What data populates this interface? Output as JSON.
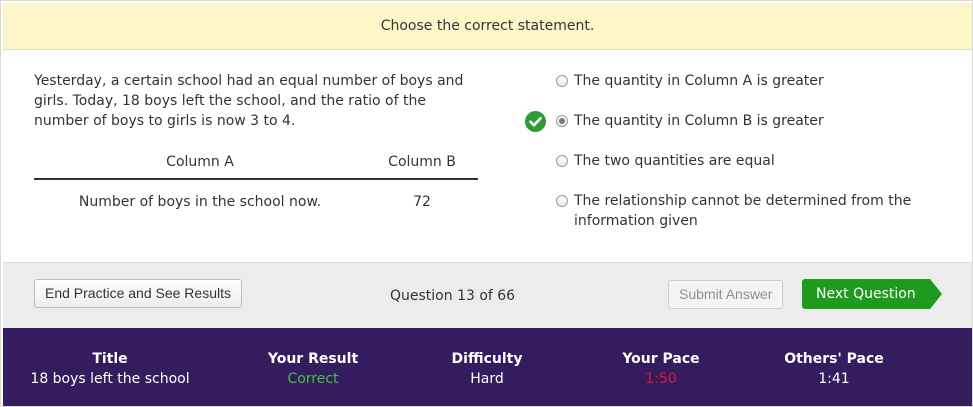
{
  "banner": {
    "text": "Choose the correct statement."
  },
  "question": {
    "text": "Yesterday, a certain school had an equal number of boys and girls. Today, 18 boys left the school, and the ratio of the number of boys to girls is now 3 to 4."
  },
  "table": {
    "column_a_header": "Column A",
    "column_b_header": "Column B",
    "column_a_value": "Number of boys in the school now.",
    "column_b_value": "72"
  },
  "options": [
    {
      "label": "The quantity in Column A is greater",
      "selected": false,
      "correct": false
    },
    {
      "label": "The quantity in Column B is greater",
      "selected": true,
      "correct": true
    },
    {
      "label": "The two quantities are equal",
      "selected": false,
      "correct": false
    },
    {
      "label": "The relationship cannot be determined from the information given",
      "selected": false,
      "correct": false
    }
  ],
  "actions": {
    "end_label": "End Practice and See Results",
    "question_counter": "Question 13 of 66",
    "submit_label": "Submit Answer",
    "next_label": "Next Question"
  },
  "stats": {
    "title_label": "Title",
    "title_value": "18 boys left the school",
    "result_label": "Your Result",
    "result_value": "Correct",
    "difficulty_label": "Difficulty",
    "difficulty_value": "Hard",
    "pace_label": "Your Pace",
    "pace_value": "1:50",
    "others_pace_label": "Others' Pace",
    "others_pace_value": "1:41"
  },
  "colors": {
    "banner_bg": "#fcf6c8",
    "correct_green": "#2e9b35",
    "next_button": "#1e9a1e",
    "stats_bg": "#341c5e",
    "result_green": "#3fc23f",
    "pace_red": "#d81f3a"
  },
  "icons": {
    "correct_marker": "checkmark-icon"
  }
}
